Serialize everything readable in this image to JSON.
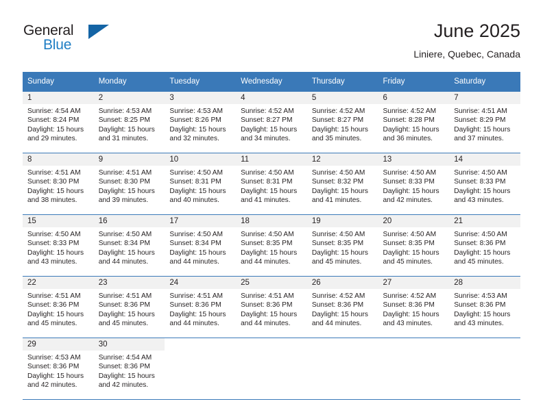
{
  "brand": {
    "word_one": "General",
    "word_two": "Blue",
    "triangle_icon": "blue-triangle-icon"
  },
  "header": {
    "title": "June 2025",
    "subtitle": "Liniere, Quebec, Canada"
  },
  "colors": {
    "header_blue": "#3a79b8",
    "brand_blue": "#1f7ec4",
    "triangle_blue": "#1464a5",
    "daynum_strip": "#f1f1f1",
    "text": "#231f20"
  },
  "weekdays": [
    "Sunday",
    "Monday",
    "Tuesday",
    "Wednesday",
    "Thursday",
    "Friday",
    "Saturday"
  ],
  "weeks": [
    [
      {
        "day": "1",
        "sunrise": "Sunrise: 4:54 AM",
        "sunset": "Sunset: 8:24 PM",
        "daylight1": "Daylight: 15 hours",
        "daylight2": "and 29 minutes."
      },
      {
        "day": "2",
        "sunrise": "Sunrise: 4:53 AM",
        "sunset": "Sunset: 8:25 PM",
        "daylight1": "Daylight: 15 hours",
        "daylight2": "and 31 minutes."
      },
      {
        "day": "3",
        "sunrise": "Sunrise: 4:53 AM",
        "sunset": "Sunset: 8:26 PM",
        "daylight1": "Daylight: 15 hours",
        "daylight2": "and 32 minutes."
      },
      {
        "day": "4",
        "sunrise": "Sunrise: 4:52 AM",
        "sunset": "Sunset: 8:27 PM",
        "daylight1": "Daylight: 15 hours",
        "daylight2": "and 34 minutes."
      },
      {
        "day": "5",
        "sunrise": "Sunrise: 4:52 AM",
        "sunset": "Sunset: 8:27 PM",
        "daylight1": "Daylight: 15 hours",
        "daylight2": "and 35 minutes."
      },
      {
        "day": "6",
        "sunrise": "Sunrise: 4:52 AM",
        "sunset": "Sunset: 8:28 PM",
        "daylight1": "Daylight: 15 hours",
        "daylight2": "and 36 minutes."
      },
      {
        "day": "7",
        "sunrise": "Sunrise: 4:51 AM",
        "sunset": "Sunset: 8:29 PM",
        "daylight1": "Daylight: 15 hours",
        "daylight2": "and 37 minutes."
      }
    ],
    [
      {
        "day": "8",
        "sunrise": "Sunrise: 4:51 AM",
        "sunset": "Sunset: 8:30 PM",
        "daylight1": "Daylight: 15 hours",
        "daylight2": "and 38 minutes."
      },
      {
        "day": "9",
        "sunrise": "Sunrise: 4:51 AM",
        "sunset": "Sunset: 8:30 PM",
        "daylight1": "Daylight: 15 hours",
        "daylight2": "and 39 minutes."
      },
      {
        "day": "10",
        "sunrise": "Sunrise: 4:50 AM",
        "sunset": "Sunset: 8:31 PM",
        "daylight1": "Daylight: 15 hours",
        "daylight2": "and 40 minutes."
      },
      {
        "day": "11",
        "sunrise": "Sunrise: 4:50 AM",
        "sunset": "Sunset: 8:31 PM",
        "daylight1": "Daylight: 15 hours",
        "daylight2": "and 41 minutes."
      },
      {
        "day": "12",
        "sunrise": "Sunrise: 4:50 AM",
        "sunset": "Sunset: 8:32 PM",
        "daylight1": "Daylight: 15 hours",
        "daylight2": "and 41 minutes."
      },
      {
        "day": "13",
        "sunrise": "Sunrise: 4:50 AM",
        "sunset": "Sunset: 8:33 PM",
        "daylight1": "Daylight: 15 hours",
        "daylight2": "and 42 minutes."
      },
      {
        "day": "14",
        "sunrise": "Sunrise: 4:50 AM",
        "sunset": "Sunset: 8:33 PM",
        "daylight1": "Daylight: 15 hours",
        "daylight2": "and 43 minutes."
      }
    ],
    [
      {
        "day": "15",
        "sunrise": "Sunrise: 4:50 AM",
        "sunset": "Sunset: 8:33 PM",
        "daylight1": "Daylight: 15 hours",
        "daylight2": "and 43 minutes."
      },
      {
        "day": "16",
        "sunrise": "Sunrise: 4:50 AM",
        "sunset": "Sunset: 8:34 PM",
        "daylight1": "Daylight: 15 hours",
        "daylight2": "and 44 minutes."
      },
      {
        "day": "17",
        "sunrise": "Sunrise: 4:50 AM",
        "sunset": "Sunset: 8:34 PM",
        "daylight1": "Daylight: 15 hours",
        "daylight2": "and 44 minutes."
      },
      {
        "day": "18",
        "sunrise": "Sunrise: 4:50 AM",
        "sunset": "Sunset: 8:35 PM",
        "daylight1": "Daylight: 15 hours",
        "daylight2": "and 44 minutes."
      },
      {
        "day": "19",
        "sunrise": "Sunrise: 4:50 AM",
        "sunset": "Sunset: 8:35 PM",
        "daylight1": "Daylight: 15 hours",
        "daylight2": "and 45 minutes."
      },
      {
        "day": "20",
        "sunrise": "Sunrise: 4:50 AM",
        "sunset": "Sunset: 8:35 PM",
        "daylight1": "Daylight: 15 hours",
        "daylight2": "and 45 minutes."
      },
      {
        "day": "21",
        "sunrise": "Sunrise: 4:50 AM",
        "sunset": "Sunset: 8:36 PM",
        "daylight1": "Daylight: 15 hours",
        "daylight2": "and 45 minutes."
      }
    ],
    [
      {
        "day": "22",
        "sunrise": "Sunrise: 4:51 AM",
        "sunset": "Sunset: 8:36 PM",
        "daylight1": "Daylight: 15 hours",
        "daylight2": "and 45 minutes."
      },
      {
        "day": "23",
        "sunrise": "Sunrise: 4:51 AM",
        "sunset": "Sunset: 8:36 PM",
        "daylight1": "Daylight: 15 hours",
        "daylight2": "and 45 minutes."
      },
      {
        "day": "24",
        "sunrise": "Sunrise: 4:51 AM",
        "sunset": "Sunset: 8:36 PM",
        "daylight1": "Daylight: 15 hours",
        "daylight2": "and 44 minutes."
      },
      {
        "day": "25",
        "sunrise": "Sunrise: 4:51 AM",
        "sunset": "Sunset: 8:36 PM",
        "daylight1": "Daylight: 15 hours",
        "daylight2": "and 44 minutes."
      },
      {
        "day": "26",
        "sunrise": "Sunrise: 4:52 AM",
        "sunset": "Sunset: 8:36 PM",
        "daylight1": "Daylight: 15 hours",
        "daylight2": "and 44 minutes."
      },
      {
        "day": "27",
        "sunrise": "Sunrise: 4:52 AM",
        "sunset": "Sunset: 8:36 PM",
        "daylight1": "Daylight: 15 hours",
        "daylight2": "and 43 minutes."
      },
      {
        "day": "28",
        "sunrise": "Sunrise: 4:53 AM",
        "sunset": "Sunset: 8:36 PM",
        "daylight1": "Daylight: 15 hours",
        "daylight2": "and 43 minutes."
      }
    ],
    [
      {
        "day": "29",
        "sunrise": "Sunrise: 4:53 AM",
        "sunset": "Sunset: 8:36 PM",
        "daylight1": "Daylight: 15 hours",
        "daylight2": "and 42 minutes."
      },
      {
        "day": "30",
        "sunrise": "Sunrise: 4:54 AM",
        "sunset": "Sunset: 8:36 PM",
        "daylight1": "Daylight: 15 hours",
        "daylight2": "and 42 minutes."
      },
      null,
      null,
      null,
      null,
      null
    ]
  ]
}
